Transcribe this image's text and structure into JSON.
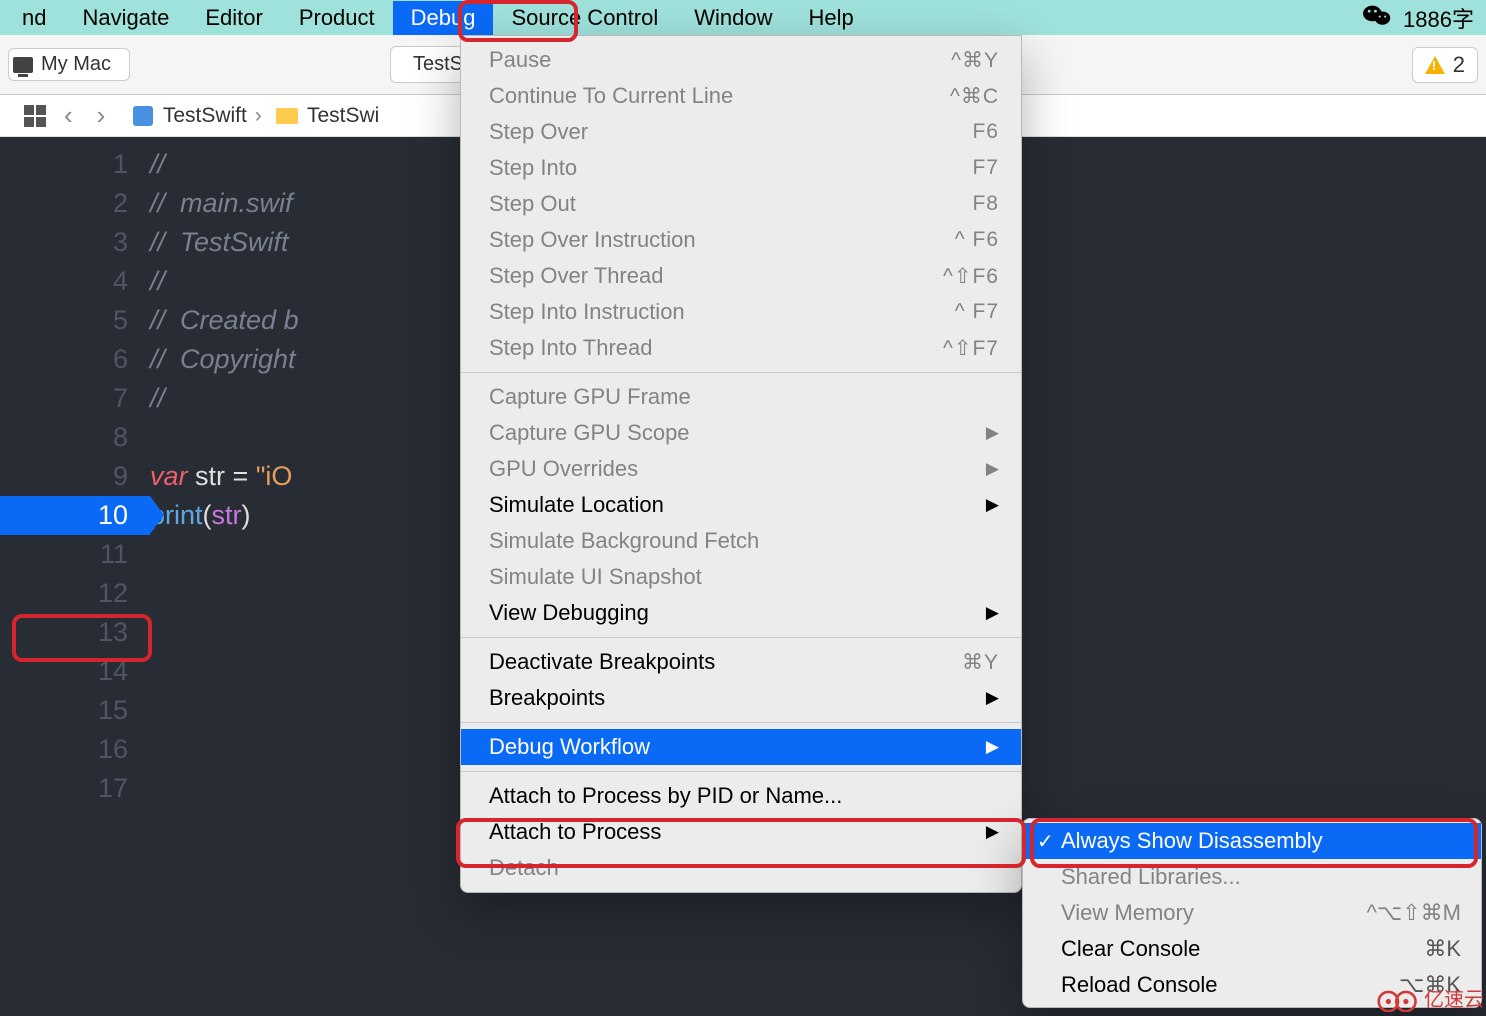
{
  "menubar": {
    "items": [
      "nd",
      "Navigate",
      "Editor",
      "Product",
      "Debug",
      "Source Control",
      "Window",
      "Help"
    ],
    "status_text": "1886字"
  },
  "toolbar": {
    "target": "My Mac",
    "scheme": "TestSwi",
    "issue_count": "2"
  },
  "navbar": {
    "project": "TestSwift",
    "folder": "TestSwi"
  },
  "code_lines": [
    {
      "n": "1",
      "cls": "cm",
      "t": "//"
    },
    {
      "n": "2",
      "cls": "cm",
      "t": "//  main.swif"
    },
    {
      "n": "3",
      "cls": "cm",
      "t": "//  TestSwift"
    },
    {
      "n": "4",
      "cls": "cm",
      "t": "//"
    },
    {
      "n": "5",
      "cls": "cm",
      "t": "//  Created b"
    },
    {
      "n": "6",
      "cls": "cm",
      "t": "//  Copyright                          s reserved."
    },
    {
      "n": "7",
      "cls": "cm",
      "t": "//"
    },
    {
      "n": "8",
      "cls": "",
      "t": ""
    },
    {
      "n": "9",
      "cls": "",
      "html": "<span class='kw'>var</span> <span class='id'>str</span> <span class='op'>=</span> <span class='str'>\"iO</span>"
    },
    {
      "n": "10",
      "bp": true,
      "cls": "",
      "html": "<span class='fn'>print</span><span class='op'>(</span><span class='pr'>str</span><span class='op'>)</span>"
    },
    {
      "n": "11",
      "cls": "",
      "t": ""
    },
    {
      "n": "12",
      "cls": "",
      "t": ""
    },
    {
      "n": "13",
      "cls": "",
      "t": ""
    },
    {
      "n": "14",
      "cls": "",
      "t": ""
    },
    {
      "n": "15",
      "cls": "",
      "t": ""
    },
    {
      "n": "16",
      "cls": "",
      "t": ""
    },
    {
      "n": "17",
      "cls": "",
      "t": ""
    }
  ],
  "debug_menu": [
    {
      "type": "sect",
      "items": [
        {
          "label": "Pause",
          "sc": "^⌘Y",
          "disabled": true
        },
        {
          "label": "Continue To Current Line",
          "sc": "^⌘C",
          "disabled": true
        },
        {
          "label": "Step Over",
          "sc": "F6",
          "disabled": true
        },
        {
          "label": "Step Into",
          "sc": "F7",
          "disabled": true
        },
        {
          "label": "Step Out",
          "sc": "F8",
          "disabled": true
        },
        {
          "label": "Step Over Instruction",
          "sc": "^  F6",
          "disabled": true
        },
        {
          "label": "Step Over Thread",
          "sc": "^⇧F6",
          "disabled": true
        },
        {
          "label": "Step Into Instruction",
          "sc": "^  F7",
          "disabled": true
        },
        {
          "label": "Step Into Thread",
          "sc": "^⇧F7",
          "disabled": true
        }
      ]
    },
    {
      "type": "sep"
    },
    {
      "type": "sect",
      "items": [
        {
          "label": "Capture GPU Frame",
          "disabled": true
        },
        {
          "label": "Capture GPU Scope",
          "arrow": true,
          "disabled": true
        },
        {
          "label": "GPU Overrides",
          "arrow": true,
          "disabled": true
        },
        {
          "label": "Simulate Location",
          "arrow": true
        },
        {
          "label": "Simulate Background Fetch",
          "disabled": true
        },
        {
          "label": "Simulate UI Snapshot",
          "disabled": true
        },
        {
          "label": "View Debugging",
          "arrow": true
        }
      ]
    },
    {
      "type": "sep"
    },
    {
      "type": "sect",
      "items": [
        {
          "label": "Deactivate Breakpoints",
          "sc": "⌘Y"
        },
        {
          "label": "Breakpoints",
          "arrow": true
        }
      ]
    },
    {
      "type": "sep"
    },
    {
      "type": "sect",
      "items": [
        {
          "label": "Debug Workflow",
          "arrow": true,
          "selected": true
        }
      ]
    },
    {
      "type": "sep"
    },
    {
      "type": "sect",
      "items": [
        {
          "label": "Attach to Process by PID or Name..."
        },
        {
          "label": "Attach to Process",
          "arrow": true
        },
        {
          "label": "Detach",
          "disabled": true
        }
      ]
    }
  ],
  "submenu": [
    {
      "label": "Always Show Disassembly",
      "selected": true,
      "checked": true
    },
    {
      "label": "Shared Libraries...",
      "disabled": true
    },
    {
      "label": "View Memory",
      "sc": "^⌥⇧⌘M",
      "disabled": true
    },
    {
      "label": "Clear Console",
      "sc": "⌘K"
    },
    {
      "label": "Reload Console",
      "sc": "⌥⌘K"
    }
  ],
  "watermark": "亿速云"
}
